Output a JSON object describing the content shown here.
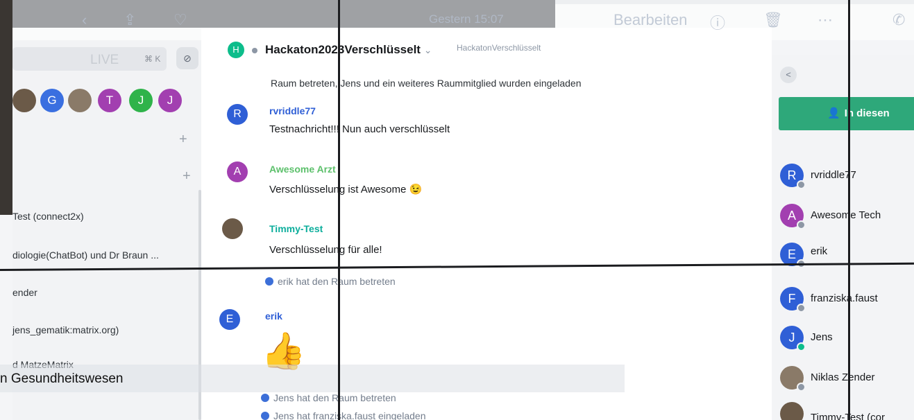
{
  "ios_bar": {
    "time": "Gestern 15:07",
    "edit_label": "Bearbeiten"
  },
  "sidebar": {
    "search_hint": "LIVE",
    "shortcut": "⌘ K",
    "space_avatars": [
      {
        "letter": "",
        "color": "#6b5a48"
      },
      {
        "letter": "G",
        "color": "#3a6fe0"
      },
      {
        "letter": "",
        "color": "#8a7a68"
      },
      {
        "letter": "T",
        "color": "#a23fb0"
      },
      {
        "letter": "J",
        "color": "#2fb34a"
      },
      {
        "letter": "J",
        "color": "#a23fb0"
      }
    ],
    "rooms": [
      "Test (connect2x)",
      "diologie(ChatBot) und Dr Braun ...",
      "ender",
      "jens_gematik:matrix.org)",
      "d MatzeMatrix"
    ]
  },
  "room": {
    "avatar_letter": "H",
    "title": "Hackaton2023Verschlüsselt",
    "title_chevron": "⌄",
    "topic": "HackatonVerschlüsselt"
  },
  "timeline": {
    "summary_line": "Raum betreten, Jens und ein weiteres Raummitglied wurden eingeladen",
    "messages": [
      {
        "avatar": "R",
        "avatar_color": "#2f5fd6",
        "sender": "rvriddle77",
        "sender_color": "#2f5fd6",
        "text": "Testnachricht!!! Nun auch verschlüsselt"
      },
      {
        "avatar": "A",
        "avatar_color": "#a23fb0",
        "sender": "Awesome Arzt",
        "sender_color": "#5cc06b",
        "text": "Verschlüsselung ist Awesome 😉"
      },
      {
        "avatar": "",
        "avatar_color": "#6b5a48",
        "sender": "Timmy-Test",
        "sender_color": "#0dae9c",
        "text": "Verschlüsselung für alle!"
      }
    ],
    "event_erik_joined": "erik hat den Raum betreten",
    "erik": {
      "avatar": "E",
      "avatar_color": "#2f5fd6",
      "sender": "erik",
      "sender_color": "#2f5fd6",
      "emoji": "👍"
    },
    "event_jens_joined": "Jens hat den Raum betreten",
    "event_jens_invited": "Jens hat franziska.faust eingeladen"
  },
  "right_panel": {
    "back": "<",
    "invite_label": "In diesen",
    "members": [
      {
        "avatar": "R",
        "color": "#2f5fd6",
        "name": "rvriddle77"
      },
      {
        "avatar": "A",
        "color": "#a23fb0",
        "name": "Awesome Tech"
      },
      {
        "avatar": "E",
        "color": "#2f5fd6",
        "name": "erik"
      },
      {
        "avatar": "F",
        "color": "#2f5fd6",
        "name": "franziska.faust"
      },
      {
        "avatar": "J",
        "color": "#2f5fd6",
        "name": "Jens"
      },
      {
        "avatar": "",
        "color": "#8a7a68",
        "name": "Niklas Zender"
      },
      {
        "avatar": "",
        "color": "#6b5a48",
        "name": "Timmy-Test (cor"
      }
    ]
  },
  "overlay_caption": "n Gesundheitswesen"
}
